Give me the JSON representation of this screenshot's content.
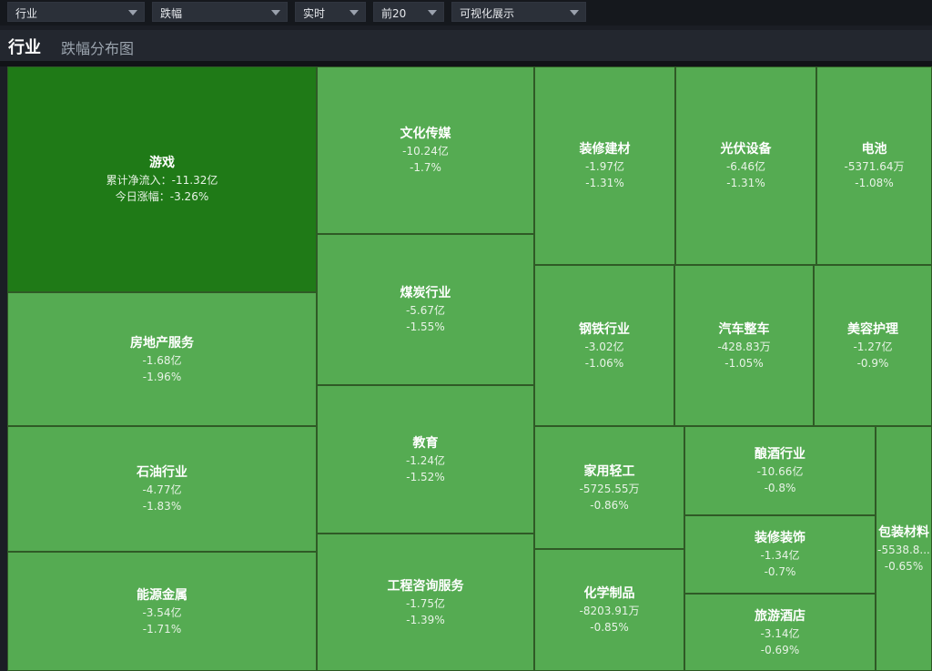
{
  "toolbar": {
    "filters": [
      {
        "id": "category",
        "label": "行业"
      },
      {
        "id": "metric",
        "label": "跌幅"
      },
      {
        "id": "period",
        "label": "实时"
      },
      {
        "id": "top",
        "label": "前20"
      },
      {
        "id": "view",
        "label": "可视化展示"
      }
    ]
  },
  "header": {
    "title": "行业",
    "subtitle": "跌幅分布图"
  },
  "colors": {
    "cell": "#55ab52",
    "cell_highlight": "#1f7a17",
    "border": "#2f5a26"
  },
  "chart_data": {
    "type": "treemap",
    "labels": {
      "net_flow": "累计净流入：",
      "change": "今日涨幅："
    },
    "items": [
      {
        "name": "游戏",
        "net_flow": "-11.32亿",
        "change": "-3.26%",
        "change_value": -3.26,
        "highlight": true
      },
      {
        "name": "房地产服务",
        "net_flow": "-1.68亿",
        "change": "-1.96%",
        "change_value": -1.96
      },
      {
        "name": "石油行业",
        "net_flow": "-4.77亿",
        "change": "-1.83%",
        "change_value": -1.83
      },
      {
        "name": "能源金属",
        "net_flow": "-3.54亿",
        "change": "-1.71%",
        "change_value": -1.71
      },
      {
        "name": "文化传媒",
        "net_flow": "-10.24亿",
        "change": "-1.7%",
        "change_value": -1.7
      },
      {
        "name": "煤炭行业",
        "net_flow": "-5.67亿",
        "change": "-1.55%",
        "change_value": -1.55
      },
      {
        "name": "教育",
        "net_flow": "-1.24亿",
        "change": "-1.52%",
        "change_value": -1.52
      },
      {
        "name": "工程咨询服务",
        "net_flow": "-1.75亿",
        "change": "-1.39%",
        "change_value": -1.39
      },
      {
        "name": "装修建材",
        "net_flow": "-1.97亿",
        "change": "-1.31%",
        "change_value": -1.31
      },
      {
        "name": "光伏设备",
        "net_flow": "-6.46亿",
        "change": "-1.31%",
        "change_value": -1.31
      },
      {
        "name": "电池",
        "net_flow": "-5371.64万",
        "change": "-1.08%",
        "change_value": -1.08
      },
      {
        "name": "钢铁行业",
        "net_flow": "-3.02亿",
        "change": "-1.06%",
        "change_value": -1.06
      },
      {
        "name": "汽车整车",
        "net_flow": "-428.83万",
        "change": "-1.05%",
        "change_value": -1.05
      },
      {
        "name": "美容护理",
        "net_flow": "-1.27亿",
        "change": "-0.9%",
        "change_value": -0.9
      },
      {
        "name": "家用轻工",
        "net_flow": "-5725.55万",
        "change": "-0.86%",
        "change_value": -0.86
      },
      {
        "name": "化学制品",
        "net_flow": "-8203.91万",
        "change": "-0.85%",
        "change_value": -0.85
      },
      {
        "name": "酿酒行业",
        "net_flow": "-10.66亿",
        "change": "-0.8%",
        "change_value": -0.8
      },
      {
        "name": "装修装饰",
        "net_flow": "-1.34亿",
        "change": "-0.7%",
        "change_value": -0.7
      },
      {
        "name": "旅游酒店",
        "net_flow": "-3.14亿",
        "change": "-0.69%",
        "change_value": -0.69
      },
      {
        "name": "包装材料",
        "net_flow": "-5538.8...",
        "change": "-0.65%",
        "change_value": -0.65
      }
    ]
  }
}
